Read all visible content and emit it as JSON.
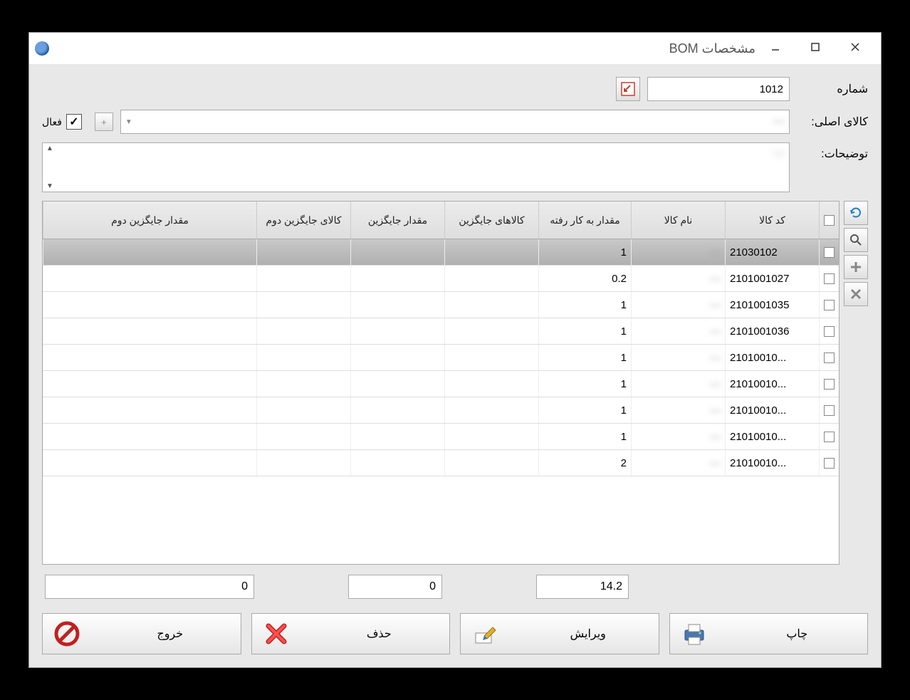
{
  "window": {
    "title": "مشخصات BOM"
  },
  "form": {
    "number_label": "شماره",
    "number_value": "1012",
    "main_item_label": "کالای اصلی:",
    "main_item_value": "—",
    "description_label": "توضیحات:",
    "description_value": "—",
    "active_label": "فعال",
    "active_checked": true
  },
  "grid": {
    "headers": {
      "code": "کد کالا",
      "name": "نام کالا",
      "qty": "مقدار به کار رفته",
      "alt": "کالاهای جایگزین",
      "altq": "مقدار جایگزین",
      "alt2": "کالای جایگزین دوم",
      "alt2q": "مقدار جایگزین دوم"
    },
    "rows": [
      {
        "code": "21030102",
        "name": "—",
        "qty": "1",
        "selected": true
      },
      {
        "code": "2101001027",
        "name": "—",
        "qty": "0.2",
        "selected": false
      },
      {
        "code": "2101001035",
        "name": "—",
        "qty": "1",
        "selected": false
      },
      {
        "code": "2101001036",
        "name": "—",
        "qty": "1",
        "selected": false
      },
      {
        "code": "21010010...",
        "name": "—",
        "qty": "1",
        "selected": false
      },
      {
        "code": "21010010...",
        "name": "—",
        "qty": "1",
        "selected": false
      },
      {
        "code": "21010010...",
        "name": "—",
        "qty": "1",
        "selected": false
      },
      {
        "code": "21010010...",
        "name": "—",
        "qty": "1",
        "selected": false
      },
      {
        "code": "21010010...",
        "name": "—",
        "qty": "2",
        "selected": false
      }
    ],
    "footer": {
      "qty_total": "14.2",
      "altq_total": "0",
      "alt2q_total": "0"
    }
  },
  "buttons": {
    "print": "چاپ",
    "edit": "ویرایش",
    "delete": "حذف",
    "exit": "خروج"
  }
}
